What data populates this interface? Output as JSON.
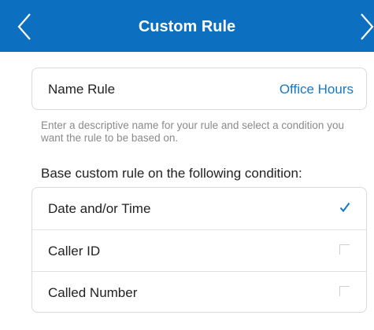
{
  "header": {
    "title": "Custom Rule",
    "back_icon": "chevron-left-icon",
    "forward_icon": "chevron-right-icon",
    "background_color": "#0d6fbf"
  },
  "name_rule": {
    "label": "Name Rule",
    "value": "Office Hours",
    "value_color": "#1778c4"
  },
  "hint": "Enter a descriptive name for your rule and select a condition you want the rule to be based on.",
  "conditions": {
    "heading": "Base custom rule on the following condition:",
    "items": [
      {
        "label": "Date and/or Time",
        "checked": true
      },
      {
        "label": "Caller ID",
        "checked": false
      },
      {
        "label": "Called Number",
        "checked": false
      }
    ]
  }
}
